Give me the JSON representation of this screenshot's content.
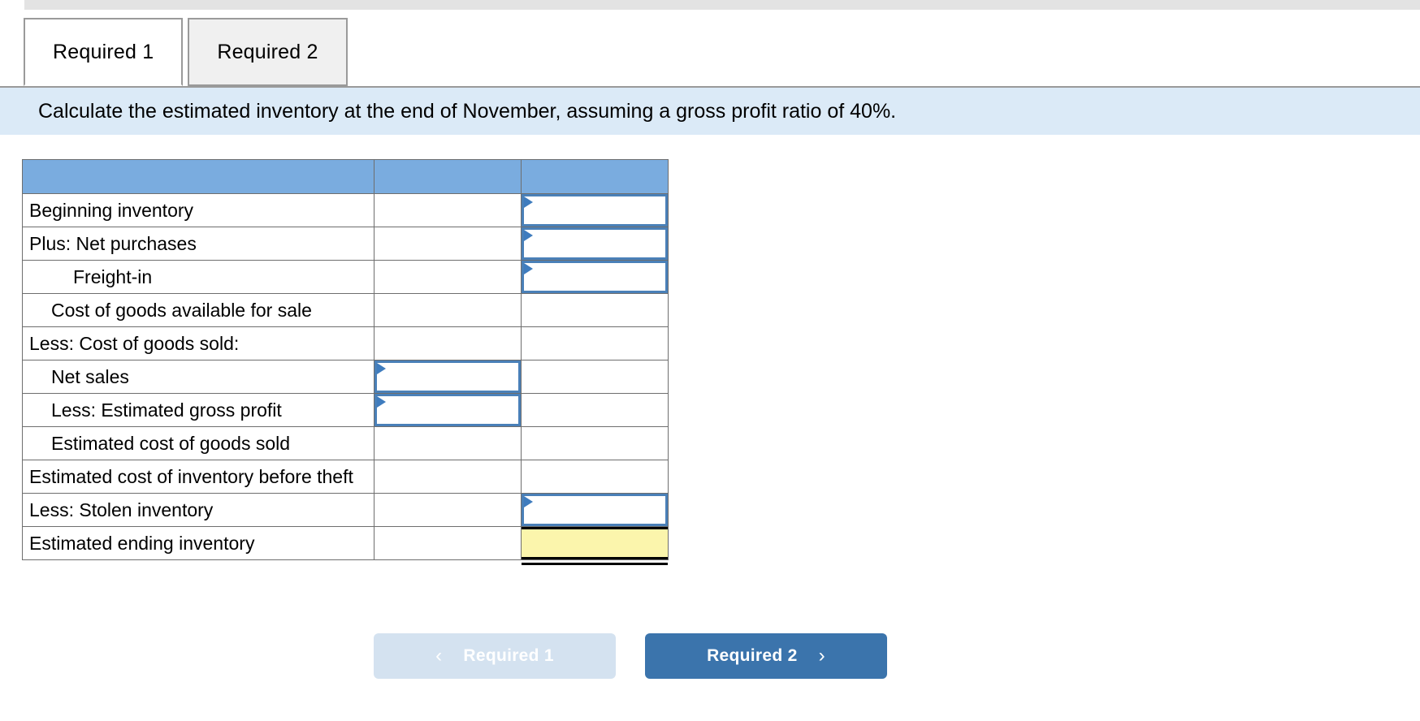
{
  "tabs": [
    {
      "label": "Required 1",
      "active": true
    },
    {
      "label": "Required 2",
      "active": false
    }
  ],
  "instruction": "Calculate the estimated inventory at the end of November, assuming a gross profit ratio of 40%.",
  "table": {
    "header": [
      "",
      "",
      ""
    ],
    "rows": [
      {
        "label": "Beginning inventory",
        "indent": 0,
        "mid": "static",
        "right": "input"
      },
      {
        "label": "Plus: Net purchases",
        "indent": 0,
        "mid": "static",
        "right": "input"
      },
      {
        "label": "Freight-in",
        "indent": 2,
        "mid": "static",
        "right": "input-last"
      },
      {
        "label": "Cost of goods available for sale",
        "indent": 1,
        "mid": "static",
        "right": "static"
      },
      {
        "label": "Less: Cost of goods sold:",
        "indent": 0,
        "mid": "static",
        "right": "static"
      },
      {
        "label": "Net sales",
        "indent": 1,
        "mid": "input",
        "right": "static"
      },
      {
        "label": "Less: Estimated gross profit",
        "indent": 1,
        "mid": "input-last",
        "right": "static"
      },
      {
        "label": "Estimated cost of goods sold",
        "indent": 1,
        "mid": "static",
        "right": "rule-bottom"
      },
      {
        "label": "Estimated cost of inventory before theft",
        "indent": 0,
        "mid": "static",
        "right": "static"
      },
      {
        "label": "Less: Stolen inventory",
        "indent": 0,
        "mid": "static",
        "right": "input"
      },
      {
        "label": "Estimated ending inventory",
        "indent": 0,
        "mid": "static",
        "right": "answer"
      }
    ]
  },
  "nav": {
    "prev_label": "Required 1",
    "next_label": "Required 2",
    "prev_chevron": "‹",
    "next_chevron": "›"
  },
  "colors": {
    "header_blue": "#7aacdf",
    "instruction_blue": "#dbeaf7",
    "input_border": "#4a80b8",
    "answer_yellow": "#fbf5ac",
    "next_button": "#3b74ac",
    "prev_button": "#d4e2f0"
  }
}
